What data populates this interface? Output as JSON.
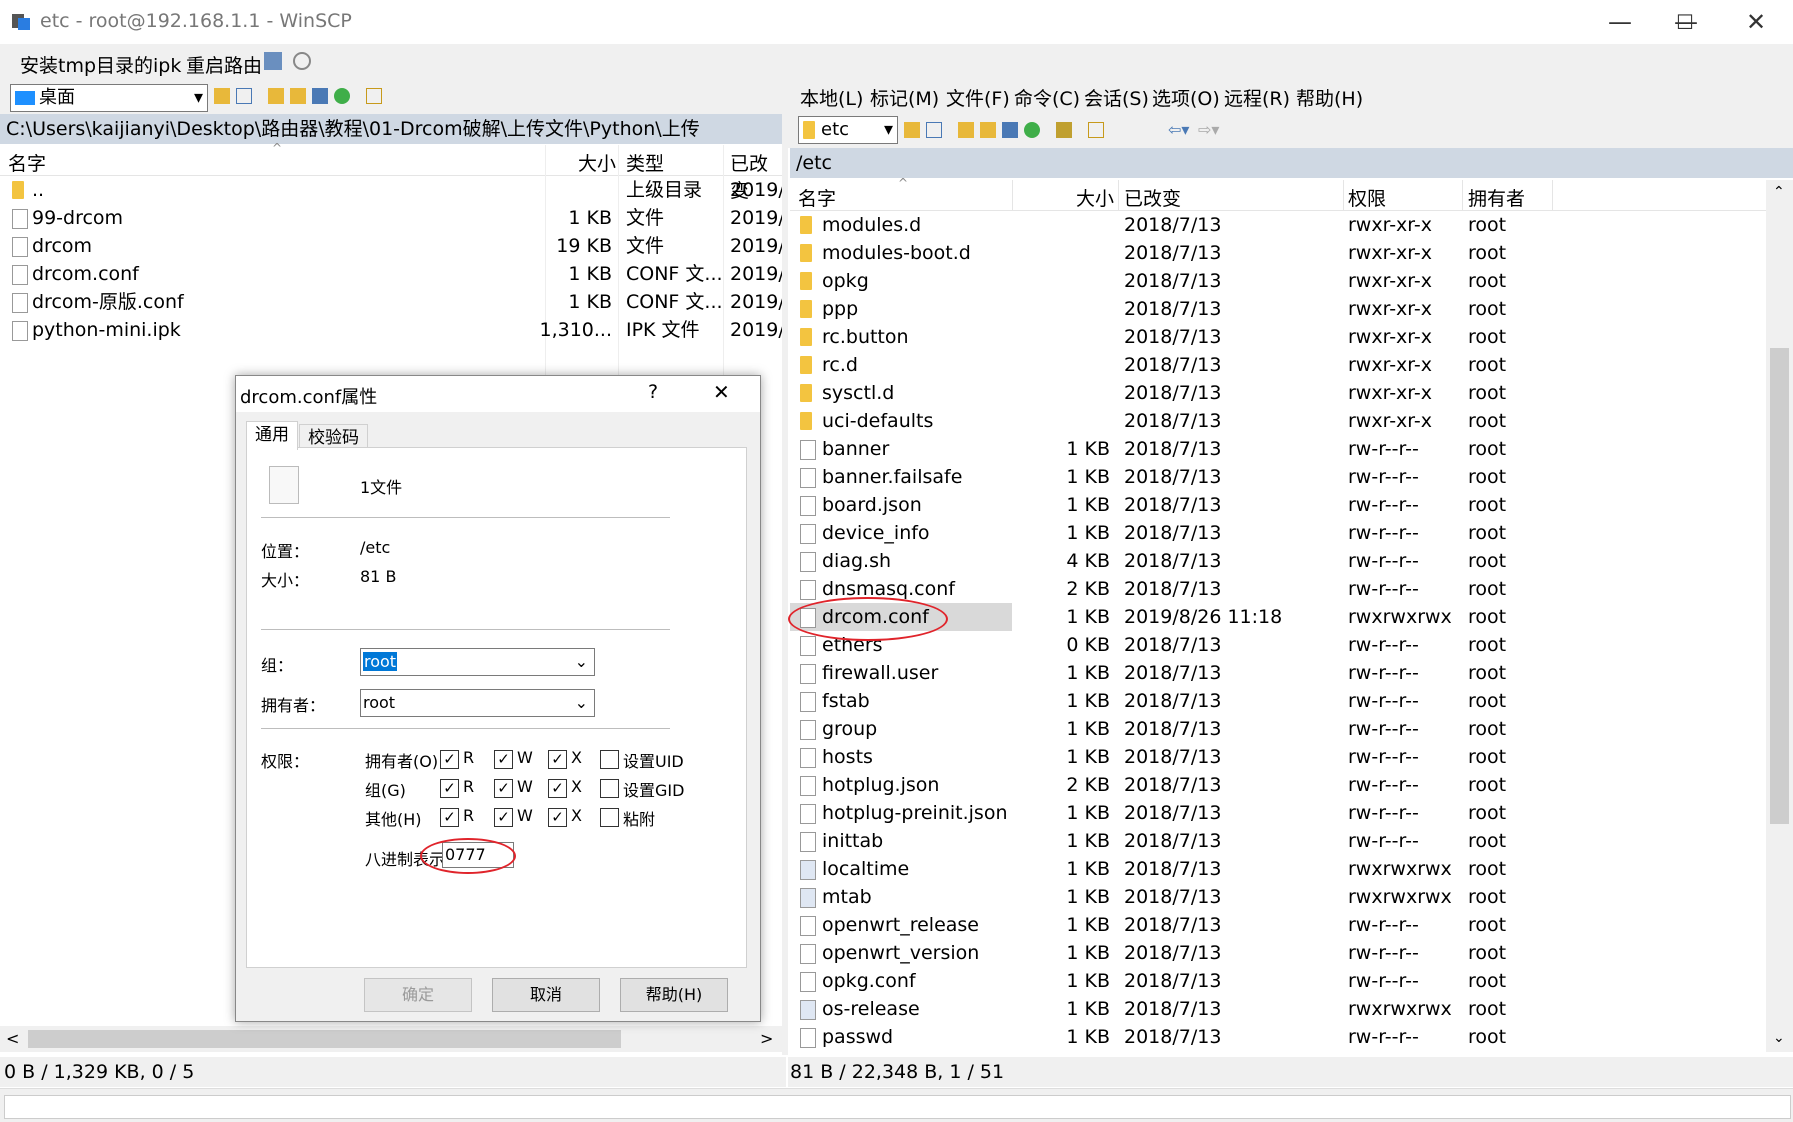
{
  "window": {
    "title": "etc - root@192.168.1.1 - WinSCP"
  },
  "toolbar": {
    "btn1": "安装tmp目录的ipk",
    "btn2": "重启路由"
  },
  "left": {
    "drive": "桌面",
    "path": "C:\\Users\\kaijianyi\\Desktop\\路由器\\教程\\01-Drcom破解\\上传文件\\Python\\上传",
    "cols": {
      "name": "名字",
      "size": "大小",
      "type": "类型",
      "changed": "已改变"
    },
    "rows": [
      {
        "name": "..",
        "size": "",
        "type": "上级目录",
        "changed": "2019/",
        "icon": "up-folder-icon"
      },
      {
        "name": "99-drcom",
        "size": "1 KB",
        "type": "文件",
        "changed": "2019/",
        "icon": "file-icon"
      },
      {
        "name": "drcom",
        "size": "19 KB",
        "type": "文件",
        "changed": "2019/",
        "icon": "file-icon"
      },
      {
        "name": "drcom.conf",
        "size": "1 KB",
        "type": "CONF 文...",
        "changed": "2019/",
        "icon": "file-icon"
      },
      {
        "name": "drcom-原版.conf",
        "size": "1 KB",
        "type": "CONF 文...",
        "changed": "2019/",
        "icon": "file-icon"
      },
      {
        "name": "python-mini.ipk",
        "size": "1,310...",
        "type": "IPK 文件",
        "changed": "2019/",
        "icon": "file-icon"
      }
    ],
    "status": "0 B / 1,329 KB,   0 / 5"
  },
  "right": {
    "menu": [
      "本地(L)",
      "标记(M)",
      "文件(F)",
      "命令(C)",
      "会话(S)",
      "选项(O)",
      "远程(R)",
      "帮助(H)"
    ],
    "dir": "etc",
    "path": "/etc",
    "cols": {
      "name": "名字",
      "size": "大小",
      "changed": "已改变",
      "rights": "权限",
      "owner": "拥有者"
    },
    "rows": [
      {
        "name": "modules.d",
        "size": "",
        "changed": "2018/7/13",
        "rights": "rwxr-xr-x",
        "owner": "root",
        "kind": "folder"
      },
      {
        "name": "modules-boot.d",
        "size": "",
        "changed": "2018/7/13",
        "rights": "rwxr-xr-x",
        "owner": "root",
        "kind": "folder"
      },
      {
        "name": "opkg",
        "size": "",
        "changed": "2018/7/13",
        "rights": "rwxr-xr-x",
        "owner": "root",
        "kind": "folder"
      },
      {
        "name": "ppp",
        "size": "",
        "changed": "2018/7/13",
        "rights": "rwxr-xr-x",
        "owner": "root",
        "kind": "folder"
      },
      {
        "name": "rc.button",
        "size": "",
        "changed": "2018/7/13",
        "rights": "rwxr-xr-x",
        "owner": "root",
        "kind": "folder"
      },
      {
        "name": "rc.d",
        "size": "",
        "changed": "2018/7/13",
        "rights": "rwxr-xr-x",
        "owner": "root",
        "kind": "folder"
      },
      {
        "name": "sysctl.d",
        "size": "",
        "changed": "2018/7/13",
        "rights": "rwxr-xr-x",
        "owner": "root",
        "kind": "folder"
      },
      {
        "name": "uci-defaults",
        "size": "",
        "changed": "2018/7/13",
        "rights": "rwxr-xr-x",
        "owner": "root",
        "kind": "folder"
      },
      {
        "name": "banner",
        "size": "1 KB",
        "changed": "2018/7/13",
        "rights": "rw-r--r--",
        "owner": "root",
        "kind": "file"
      },
      {
        "name": "banner.failsafe",
        "size": "1 KB",
        "changed": "2018/7/13",
        "rights": "rw-r--r--",
        "owner": "root",
        "kind": "file"
      },
      {
        "name": "board.json",
        "size": "1 KB",
        "changed": "2018/7/13",
        "rights": "rw-r--r--",
        "owner": "root",
        "kind": "file"
      },
      {
        "name": "device_info",
        "size": "1 KB",
        "changed": "2018/7/13",
        "rights": "rw-r--r--",
        "owner": "root",
        "kind": "file"
      },
      {
        "name": "diag.sh",
        "size": "4 KB",
        "changed": "2018/7/13",
        "rights": "rw-r--r--",
        "owner": "root",
        "kind": "file"
      },
      {
        "name": "dnsmasq.conf",
        "size": "2 KB",
        "changed": "2018/7/13",
        "rights": "rw-r--r--",
        "owner": "root",
        "kind": "file"
      },
      {
        "name": "drcom.conf",
        "size": "1 KB",
        "changed": "2019/8/26 11:18",
        "rights": "rwxrwxrwx",
        "owner": "root",
        "kind": "file",
        "selected": true
      },
      {
        "name": "ethers",
        "size": "0 KB",
        "changed": "2018/7/13",
        "rights": "rw-r--r--",
        "owner": "root",
        "kind": "file"
      },
      {
        "name": "firewall.user",
        "size": "1 KB",
        "changed": "2018/7/13",
        "rights": "rw-r--r--",
        "owner": "root",
        "kind": "file"
      },
      {
        "name": "fstab",
        "size": "1 KB",
        "changed": "2018/7/13",
        "rights": "rw-r--r--",
        "owner": "root",
        "kind": "file"
      },
      {
        "name": "group",
        "size": "1 KB",
        "changed": "2018/7/13",
        "rights": "rw-r--r--",
        "owner": "root",
        "kind": "file"
      },
      {
        "name": "hosts",
        "size": "1 KB",
        "changed": "2018/7/13",
        "rights": "rw-r--r--",
        "owner": "root",
        "kind": "file"
      },
      {
        "name": "hotplug.json",
        "size": "2 KB",
        "changed": "2018/7/13",
        "rights": "rw-r--r--",
        "owner": "root",
        "kind": "file"
      },
      {
        "name": "hotplug-preinit.json",
        "size": "1 KB",
        "changed": "2018/7/13",
        "rights": "rw-r--r--",
        "owner": "root",
        "kind": "file"
      },
      {
        "name": "inittab",
        "size": "1 KB",
        "changed": "2018/7/13",
        "rights": "rw-r--r--",
        "owner": "root",
        "kind": "file"
      },
      {
        "name": "localtime",
        "size": "1 KB",
        "changed": "2018/7/13",
        "rights": "rwxrwxrwx",
        "owner": "root",
        "kind": "link"
      },
      {
        "name": "mtab",
        "size": "1 KB",
        "changed": "2018/7/13",
        "rights": "rwxrwxrwx",
        "owner": "root",
        "kind": "link"
      },
      {
        "name": "openwrt_release",
        "size": "1 KB",
        "changed": "2018/7/13",
        "rights": "rw-r--r--",
        "owner": "root",
        "kind": "file"
      },
      {
        "name": "openwrt_version",
        "size": "1 KB",
        "changed": "2018/7/13",
        "rights": "rw-r--r--",
        "owner": "root",
        "kind": "file"
      },
      {
        "name": "opkg.conf",
        "size": "1 KB",
        "changed": "2018/7/13",
        "rights": "rw-r--r--",
        "owner": "root",
        "kind": "file"
      },
      {
        "name": "os-release",
        "size": "1 KB",
        "changed": "2018/7/13",
        "rights": "rwxrwxrwx",
        "owner": "root",
        "kind": "link"
      },
      {
        "name": "passwd",
        "size": "1 KB",
        "changed": "2018/7/13",
        "rights": "rw-r--r--",
        "owner": "root",
        "kind": "file"
      }
    ],
    "status": "81 B / 22,348 B,   1 / 51"
  },
  "dialog": {
    "title": "drcom.conf属性",
    "help_glyph": "?",
    "tabs": [
      "通用",
      "校验码"
    ],
    "file_count": "1文件",
    "location_label": "位置：",
    "location": "/etc",
    "size_label": "大小：",
    "size": "81 B",
    "group_label": "组：",
    "group_value": "root",
    "owner_label": "拥有者：",
    "owner_value": "root",
    "rights_label": "权限：",
    "perm_rows": [
      {
        "label": "拥有者(O)",
        "r": true,
        "w": true,
        "x": true,
        "extra": "设置UID"
      },
      {
        "label": "组(G)",
        "r": true,
        "w": true,
        "x": true,
        "extra": "设置GID"
      },
      {
        "label": "其他(H)",
        "r": true,
        "w": true,
        "x": true,
        "extra": "粘附"
      }
    ],
    "r": "R",
    "w": "W",
    "x": "X",
    "octal_label": "八进制表示",
    "octal_value": "0777",
    "ok": "确定",
    "cancel": "取消",
    "help": "帮助(H)"
  },
  "colors": {
    "accent": "#0078d7",
    "annotation": "#e0242b",
    "pathbar": "#cfd8e3"
  }
}
